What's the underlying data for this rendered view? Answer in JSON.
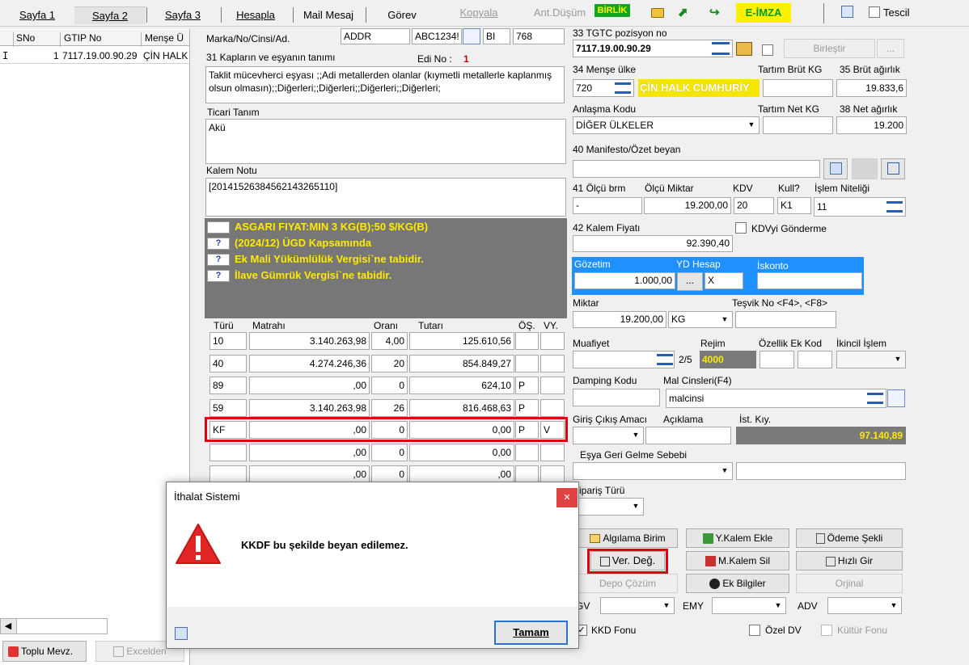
{
  "tabs": [
    "Sayfa 1",
    "Sayfa 2",
    "Sayfa 3",
    "Hesapla",
    "Mail Mesaj",
    "Görev",
    "Kopyala",
    "Ant.Düşüm",
    "BİRLİK",
    "E-İMZA",
    "Tescil"
  ],
  "left_grid": {
    "headers": [
      "SNo",
      "GTIP No",
      "Menşe Ü"
    ],
    "row": {
      "marker": "I",
      "sno": "1",
      "gtip": "7117.19.00.90.29",
      "mense": "ÇİN HALK"
    }
  },
  "left_buttons": {
    "toplu": "Toplu Mevz.",
    "excel": "Excelden"
  },
  "labels": {
    "marka": "Marka/No/Cinsi/Ad.",
    "kaplar": "31 Kapların ve eşyanın tanımı",
    "edi_no": "Edi No :",
    "ticari": "Ticari Tanım",
    "kalem_notu": "Kalem Notu",
    "tgtc": "33 TGTC pozisyon no",
    "mense": "34 Menşe ülke",
    "tartim_brut": "Tartım Brüt KG",
    "brut": "35 Brüt ağırlık",
    "anlasma": "Anlaşma Kodu",
    "tartim_net": "Tartım Net KG",
    "net": "38 Net ağırlık",
    "manifesto": "40 Manifesto/Özet beyan",
    "olcu_brm": "41 Ölçü brm",
    "olcu_miktar": "Ölçü Miktar",
    "kdv": "KDV",
    "kull": "Kull?",
    "islem": "İşlem Niteliği",
    "kalem_fiyati": "42 Kalem Fiyatı",
    "kdv_gonder": "KDVyi Gönderme",
    "gozetim": "Gözetim",
    "yd_hesap": "YD Hesap",
    "iskonto": "İskonto",
    "miktar": "Miktar",
    "tesvik": "Teşvik No <F4>, <F8>",
    "muafiyet": "Muafiyet",
    "rejim": "Rejim",
    "ozellik": "Özellik Ek Kod",
    "ikincil": "İkincil İşlem",
    "damping": "Damping Kodu",
    "mal_cins": "Mal Cinsleri(F4)",
    "giris": "Giriş Çıkış Amacı",
    "aciklama": "Açıklama",
    "ist_kiy": "İst. Kıy.",
    "esya_geri": "Eşya Geri Gelme Sebebi",
    "siparis": "Sipariş Türü",
    "tax_head": [
      "Türü",
      "Matrahı",
      "Oranı",
      "Tutarı",
      "ÖŞ.",
      "VY."
    ],
    "gv": "GV",
    "emy": "EMY",
    "adv": "ADV",
    "kkd": "KKD Fonu",
    "ozel_dv": "Özel DV",
    "kultur": "Kültür Fonu"
  },
  "values": {
    "marka1": "ADDR",
    "marka2": "ABC1234!",
    "marka3": "BI",
    "marka4": "768",
    "edi_no": "1",
    "kaplar": "Taklit mücevherci eşyası ;;Adi metallerden olanlar (kıymetli metallerle kaplanmış olsun olmasın);;Diğerleri;;Diğerleri;;Diğerleri;;Diğerleri;",
    "ticari": "Akü",
    "kalem_notu": "[20141526384562143265110]",
    "tgtc": "7117.19.00.90.29",
    "birlestir": "Birleştir",
    "mense_code": "720",
    "mense_name": "ÇİN HALK CUMHURİY",
    "brut": "19.833,6",
    "anlasma": "DİĞER ÜLKELER",
    "net": "19.200",
    "olcu_brm": "-",
    "olcu_miktar": "19.200,00",
    "kdv": "20",
    "kull": "K1",
    "islem": "11",
    "kalem_fiyati": "92.390,40",
    "gozetim": "1.000,00",
    "yd_hesap": "X",
    "miktar": "19.200,00",
    "miktar_unit": "KG",
    "muafiyet_page": "2/5",
    "rejim": "4000",
    "mal_cins": "malcinsi",
    "ist_kiy": "97.140,89"
  },
  "warnings": [
    {
      "icon": "",
      "text": "ASGARI FIYAT:MIN 3 KG(B);50 $/KG(B)"
    },
    {
      "icon": "?",
      "text": "(2024/12) ÜGD Kapsamında"
    },
    {
      "icon": "?",
      "text": "Ek Mali Yükümlülük Vergisi`ne tabidir."
    },
    {
      "icon": "?",
      "text": "İlave Gümrük Vergisi`ne tabidir."
    }
  ],
  "tax_rows": [
    {
      "tur": "10",
      "matrah": "3.140.263,98",
      "oran": "4,00",
      "tutar": "125.610,56",
      "os": "",
      "vy": ""
    },
    {
      "tur": "40",
      "matrah": "4.274.246,36",
      "oran": "20",
      "tutar": "854.849,27",
      "os": "",
      "vy": ""
    },
    {
      "tur": "89",
      "matrah": ",00",
      "oran": "0",
      "tutar": "624,10",
      "os": "P",
      "vy": ""
    },
    {
      "tur": "59",
      "matrah": "3.140.263,98",
      "oran": "26",
      "tutar": "816.468,63",
      "os": "P",
      "vy": ""
    },
    {
      "tur": "KF",
      "matrah": ",00",
      "oran": "0",
      "tutar": "0,00",
      "os": "P",
      "vy": "V"
    },
    {
      "tur": "",
      "matrah": ",00",
      "oran": "0",
      "tutar": "0,00",
      "os": "",
      "vy": ""
    },
    {
      "tur": "",
      "matrah": ",00",
      "oran": "0",
      "tutar": ",00",
      "os": "",
      "vy": ""
    }
  ],
  "action_buttons": {
    "algilama": "Algılama Birim",
    "ykalem": "Y.Kalem Ekle",
    "odeme": "Ödeme Şekli",
    "verdeg": "Ver. Değ.",
    "mkalem": "M.Kalem Sil",
    "hizli": "Hızlı Gir",
    "depo": "Depo Çözüm",
    "ek_bilgi": "Ek Bilgiler",
    "orjinal": "Orjinal"
  },
  "dialog": {
    "title": "İthalat Sistemi",
    "close": "×",
    "message": "KKDF bu şekilde beyan edilemez.",
    "ok": "Tamam"
  },
  "colors": {
    "highlight_red": "#e0000e",
    "warning_bg": "#777777",
    "warning_text": "#ffea00",
    "blue_panel": "#1e90ff"
  }
}
